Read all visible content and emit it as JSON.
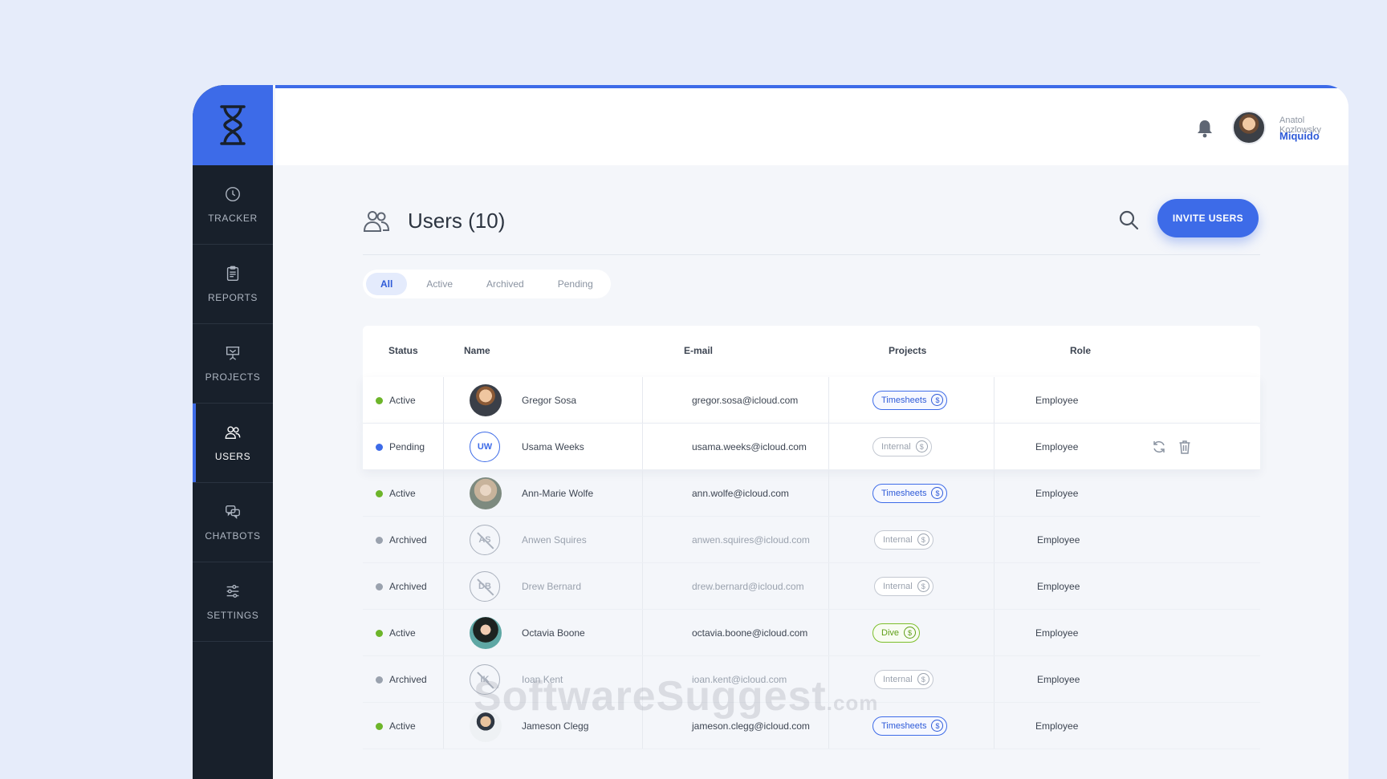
{
  "sidebar": {
    "items": [
      {
        "label": "TRACKER",
        "icon": "clock-icon"
      },
      {
        "label": "REPORTS",
        "icon": "clipboard-icon"
      },
      {
        "label": "PROJECTS",
        "icon": "presentation-board-icon"
      },
      {
        "label": "USERS",
        "icon": "users-icon",
        "active": true
      },
      {
        "label": "CHATBOTS",
        "icon": "chat-bubbles-icon"
      },
      {
        "label": "SETTINGS",
        "icon": "sliders-icon"
      }
    ]
  },
  "topbar": {
    "user_name": "Anatol Kozlowsky",
    "org": "Miquido"
  },
  "page": {
    "title": "Users (10)",
    "invite_label": "INVITE USERS"
  },
  "filters": [
    "All",
    "Active",
    "Archived",
    "Pending"
  ],
  "table": {
    "headers": {
      "status": "Status",
      "name": "Name",
      "email": "E-mail",
      "projects": "Projects",
      "role": "Role"
    },
    "rows": [
      {
        "status": "Active",
        "name": "Gregor Sosa",
        "email": "gregor.sosa@icloud.com",
        "project": "Timesheets",
        "role": "Employee",
        "avatar": "photo",
        "initials": ""
      },
      {
        "status": "Pending",
        "name": "Usama Weeks",
        "email": "usama.weeks@icloud.com",
        "project": "Internal",
        "role": "Employee",
        "avatar": "initials",
        "initials": "UW"
      },
      {
        "status": "Active",
        "name": "Ann-Marie Wolfe",
        "email": "ann.wolfe@icloud.com",
        "project": "Timesheets",
        "role": "Employee",
        "avatar": "photo",
        "initials": ""
      },
      {
        "status": "Archived",
        "name": "Anwen Squires",
        "email": "anwen.squires@icloud.com",
        "project": "Internal",
        "role": "Employee",
        "avatar": "initials",
        "initials": "AS"
      },
      {
        "status": "Archived",
        "name": "Drew Bernard",
        "email": "drew.bernard@icloud.com",
        "project": "Internal",
        "role": "Employee",
        "avatar": "initials",
        "initials": "DB"
      },
      {
        "status": "Active",
        "name": "Octavia Boone",
        "email": "octavia.boone@icloud.com",
        "project": "Dive",
        "role": "Employee",
        "avatar": "photo",
        "initials": ""
      },
      {
        "status": "Archived",
        "name": "Ioan Kent",
        "email": "ioan.kent@icloud.com",
        "project": "Internal",
        "role": "Employee",
        "avatar": "initials",
        "initials": "IK"
      },
      {
        "status": "Active",
        "name": "Jameson Clegg",
        "email": "jameson.clegg@icloud.com",
        "project": "Timesheets",
        "role": "Employee",
        "avatar": "photo",
        "initials": ""
      }
    ]
  },
  "currency_symbol": "$",
  "watermark": {
    "main": "SoftwareSuggest",
    "suffix": ".com"
  },
  "colors": {
    "accent": "#3d6be8",
    "sidebar": "#18202b",
    "active": "#6db52a",
    "pending": "#3d6be8",
    "archived": "#9aa2ae",
    "dive": "#7cbf2a"
  }
}
